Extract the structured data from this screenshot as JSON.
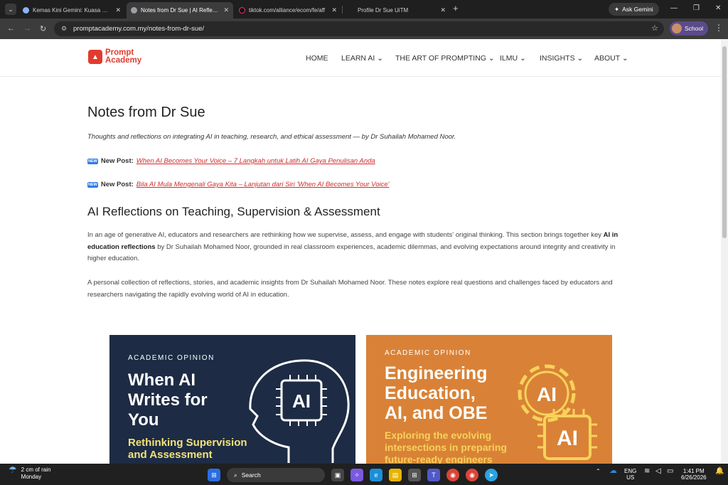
{
  "browser": {
    "tabs": [
      {
        "title": "Kemas Kini Gemini: Kuasa Bahasa",
        "active": false
      },
      {
        "title": "Notes from Dr Sue | AI Reflections",
        "active": true
      },
      {
        "title": "tiktok.com/alliance/ecom/fe/aff",
        "active": false
      },
      {
        "title": "Profile Dr Sue UiTM",
        "active": false
      }
    ],
    "ask_gemini": "Ask Gemini",
    "url": "promptacademy.com.my/notes-from-dr-sue/",
    "profile_label": "School"
  },
  "site": {
    "logo_line1": "Prompt",
    "logo_line2": "Academy",
    "nav": [
      "HOME",
      "LEARN AI",
      "THE ART OF PROMPTING",
      "ILMU",
      "INSIGHTS",
      "ABOUT"
    ]
  },
  "content": {
    "title": "Notes from Dr Sue",
    "lead": "Thoughts and reflections on integrating AI in teaching, research, and ethical assessment — by Dr Suhailah Mohamed Noor.",
    "new_badge": "NEW",
    "new_post_label": "New Post:",
    "post1": "When AI Becomes Your Voice – 7 Langkah untuk Latih AI Gaya Penulisan Anda",
    "post2": "Bila AI Mula Mengenali Gaya Kita – Lanjutan dari Siri 'When AI Becomes Your Voice'",
    "section_title": "AI Reflections on Teaching, Supervision & Assessment",
    "para1_a": "In an age of generative AI, educators and researchers are rethinking how we supervise, assess, and engage with students' original thinking. This section brings together key ",
    "para1_bold": "AI in education reflections",
    "para1_b": " by Dr Suhailah Mohamed Noor, grounded in real classroom experiences, academic dilemmas, and evolving expectations around integrity and creativity in higher education.",
    "para2": "A personal collection of reflections, stories, and academic insights from Dr Suhailah Mohamed Noor. These notes explore real questions and challenges faced by educators and researchers navigating the rapidly evolving world of AI in education."
  },
  "cards": [
    {
      "kicker": "ACADEMIC OPINION",
      "title_lines": [
        "When AI",
        "Writes for",
        "You"
      ],
      "subtitle_lines": [
        "Rethinking Supervision",
        "and Assessment"
      ],
      "ai_label": "AI"
    },
    {
      "kicker": "ACADEMIC OPINION",
      "title_lines": [
        "Engineering",
        "Education,",
        "AI, and OBE"
      ],
      "subtitle_lines": [
        "Exploring the evolving",
        "intersections in preparing",
        "future-ready engineers"
      ],
      "ai_label": "AI"
    }
  ],
  "taskbar": {
    "weather_line1": "2 cm of rain",
    "weather_line2": "Monday",
    "search": "Search",
    "lang1": "ENG",
    "lang2": "US",
    "time": "1:41 PM",
    "date": "6/26/2026"
  },
  "colors": {
    "accent": "#e23b2e",
    "card_dark": "#1d2b44",
    "card_orange": "#d98237",
    "card_dark_sub": "#f2e27a",
    "card_orange_sub": "#f7d25a"
  }
}
